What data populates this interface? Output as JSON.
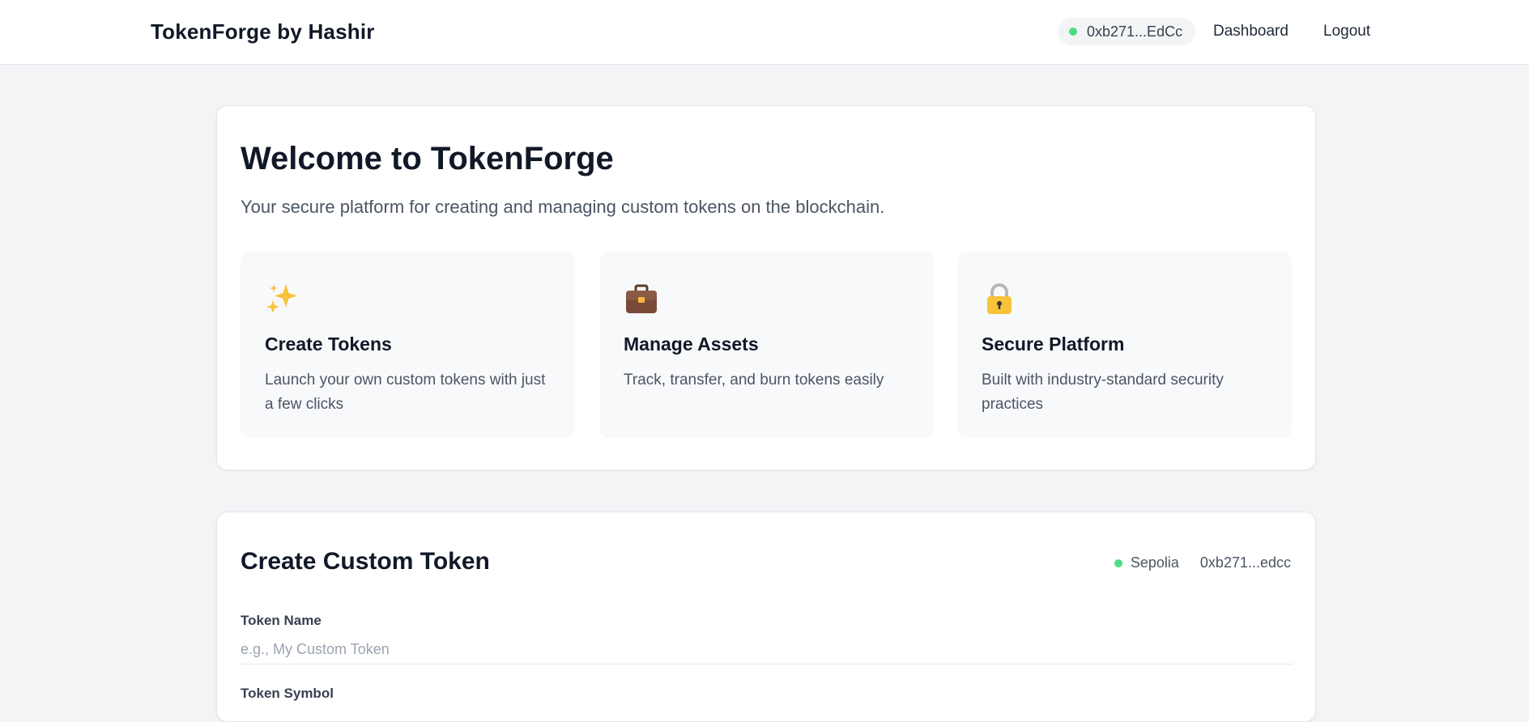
{
  "header": {
    "brand": "TokenForge by Hashir",
    "wallet_address": "0xb271...EdCc",
    "nav": {
      "dashboard": "Dashboard",
      "logout": "Logout"
    }
  },
  "welcome": {
    "title": "Welcome to TokenForge",
    "subtitle": "Your secure platform for creating and managing custom tokens on the blockchain.",
    "features": [
      {
        "icon": "sparkles-icon",
        "title": "Create Tokens",
        "description": "Launch your own custom tokens with just a few clicks"
      },
      {
        "icon": "briefcase-icon",
        "title": "Manage Assets",
        "description": "Track, transfer, and burn tokens easily"
      },
      {
        "icon": "lock-icon",
        "title": "Secure Platform",
        "description": "Built with industry-standard security practices"
      }
    ]
  },
  "create_token": {
    "title": "Create Custom Token",
    "network": "Sepolia",
    "address": "0xb271...edcc",
    "fields": {
      "name_label": "Token Name",
      "name_placeholder": "e.g., My Custom Token",
      "symbol_label": "Token Symbol"
    }
  },
  "colors": {
    "status_green": "#4ade80",
    "background": "#f3f4f6",
    "card": "#ffffff",
    "feature_bg": "#f8f9fb"
  }
}
